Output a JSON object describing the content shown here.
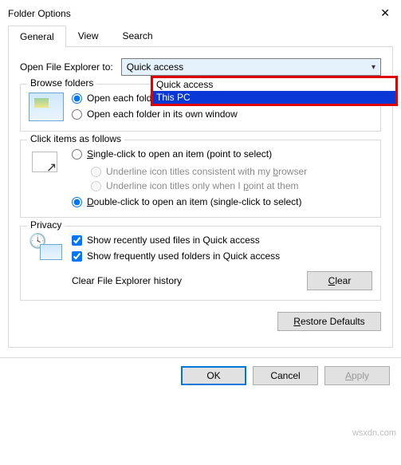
{
  "window": {
    "title": "Folder Options"
  },
  "tabs": {
    "general": "General",
    "view": "View",
    "search": "Search"
  },
  "open_to": {
    "label": "Open File Explorer to:",
    "selected": "Quick access",
    "options": {
      "quick_access": "Quick access",
      "this_pc": "This PC"
    }
  },
  "browse": {
    "legend": "Browse folders",
    "same": "Open each folder in the same window",
    "own": "Open each folder in its own window"
  },
  "click": {
    "legend": "Click items as follows",
    "single": "Single-click to open an item (point to select)",
    "ul_browser": "Underline icon titles consistent with my browser",
    "ul_point": "Underline icon titles only when I point at them",
    "double": "Double-click to open an item (single-click to select)"
  },
  "privacy": {
    "legend": "Privacy",
    "recent": "Show recently used files in Quick access",
    "frequent": "Show frequently used folders in Quick access",
    "clear_label": "Clear File Explorer history",
    "clear_btn": "Clear"
  },
  "buttons": {
    "restore": "Restore Defaults",
    "ok": "OK",
    "cancel": "Cancel",
    "apply": "Apply"
  },
  "watermark": "wsxdn.com"
}
